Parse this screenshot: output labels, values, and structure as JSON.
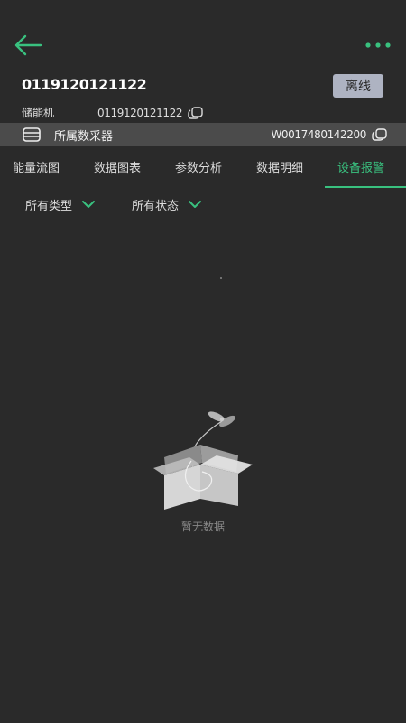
{
  "header": {
    "device_id": "0119120121122",
    "status_badge": "离线"
  },
  "info": {
    "label": "储能机",
    "value": "0119120121122"
  },
  "collector": {
    "label": "所属数采器",
    "serial": "W0017480142200"
  },
  "tabs": [
    {
      "label": "能量流图"
    },
    {
      "label": "数据图表"
    },
    {
      "label": "参数分析"
    },
    {
      "label": "数据明细"
    },
    {
      "label": "设备报警"
    }
  ],
  "active_tab": "设备报警",
  "filters": {
    "type_label": "所有类型",
    "status_label": "所有状态"
  },
  "empty_state": {
    "text": "暂无数据"
  },
  "colors": {
    "background": "#2a2a2a",
    "accent": "#39c17f",
    "badge_bg": "#aeb3c2",
    "bar_bg": "#4b4b4b"
  }
}
